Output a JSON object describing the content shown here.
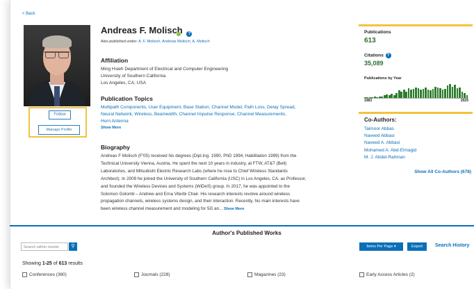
{
  "nav": {
    "back_label": "< Back"
  },
  "profile": {
    "name": "Andreas F. Molisch",
    "also_published_prefix": "Also published under:",
    "aliases": "A. F. Molisch, Andreas Molisch, A. Molisch",
    "follow_label": "Follow",
    "manage_label": "Manage Profile"
  },
  "affiliation": {
    "heading": "Affiliation",
    "lines": [
      "Ming Hsieh Department of Electrical and Computer Engineering",
      "University of Southern California",
      "Los Angeles, CA, USA"
    ]
  },
  "topics": {
    "heading": "Publication Topics",
    "line1": "Multipath Components, User Equipment, Base Station, Channel Model, Path Loss, Delay Spread,",
    "line2": "Neural Network, Wireless, Beamwidth, Channel Impulse Response, Channel Measurements,",
    "line3": "Horn Antenna",
    "show_more": "Show More"
  },
  "biography": {
    "heading": "Biography",
    "lines": [
      "Andreas F Molisch (F'05) received his degrees (Dipl.Ing. 1990, PhD 1994, Habilitation 1999) from the",
      "Technical University Vienna, Austria. He spent the next 10 years in industry, at FTW, AT&T (Bell)",
      "Laboratories, and Mitsubishi Electric Research Labs (where he rose to Chief Wireless Standards",
      "Architect). In 2009 he joined the University of Southern California (USC) in Los Angeles, CA, as Professor,",
      "and founded the Wireless Devices and Systems (WiDeS) group. In 2017, he was appointed to the",
      "Solomon Golomb – Andrew and Erna Viterbi Chair. His research interests revolve around wireless",
      "propagation channels, wireless systems design, and their interaction. Recently, his main interests have",
      "been wireless channel measurement and modeling for 5G an..."
    ],
    "show_more": "Show More"
  },
  "metrics": {
    "publications_label": "Publications",
    "publications_value": "613",
    "citations_label": "Citations",
    "citations_value": "35,089",
    "by_year_label": "Publications by Year",
    "year_start": "1983",
    "year_end": "2025",
    "bars": [
      1,
      1,
      1,
      1,
      2,
      1,
      2,
      2,
      3,
      4,
      3,
      5,
      3,
      6,
      9,
      8,
      10,
      8,
      12,
      10,
      11,
      13,
      12,
      10,
      11,
      13,
      10,
      9,
      11,
      14,
      13,
      12,
      10,
      11,
      15,
      17,
      14,
      16,
      12,
      13,
      8,
      6,
      3
    ]
  },
  "coauthors": {
    "heading": "Co-Authors:",
    "names": [
      "Taimoor Abbas",
      "Naveed Abbasi",
      "Naveed A. Abbasi",
      "Mohamed A. Abd-Elmagid",
      "M. J. Abdel-Rahman"
    ],
    "show_all": "Show All Co-Authors (678)"
  },
  "works": {
    "heading": "Author's Published Works",
    "search_placeholder": "Search within results",
    "items_per_page": "Items Per Page ▾",
    "export": "Export",
    "search_history": "Search History",
    "showing_prefix": "Showing",
    "showing_range": "1-25",
    "showing_of": "of",
    "showing_total": "613",
    "showing_suffix": "results",
    "filters": [
      "Conferences (360)",
      "Journals (228)",
      "Magazines (23)",
      "Early Access Articles (2)"
    ]
  }
}
